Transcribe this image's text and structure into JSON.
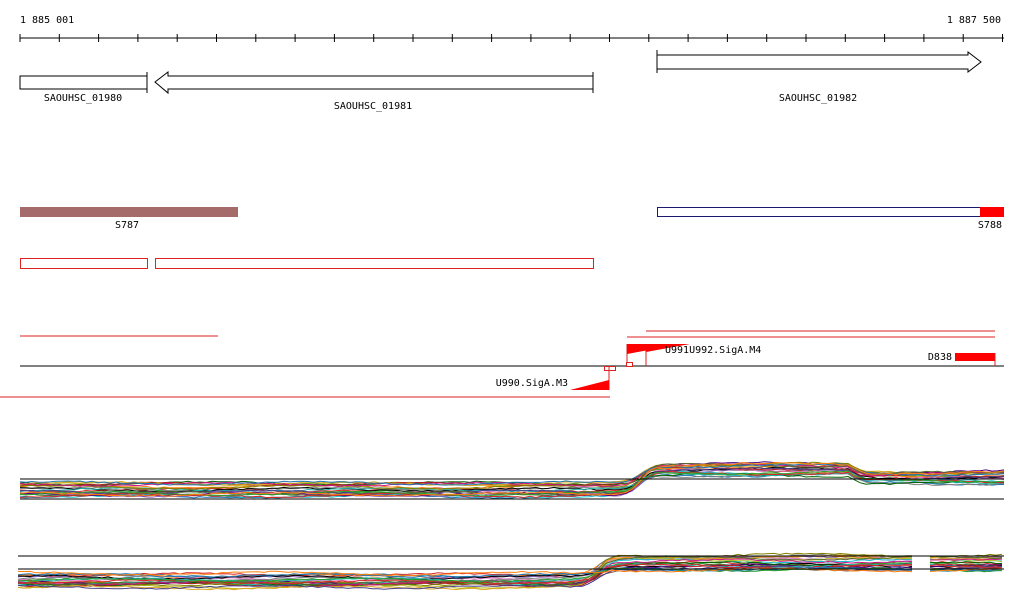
{
  "ruler": {
    "start_label": "1 885 001",
    "end_label": "1 887 500"
  },
  "genes": [
    {
      "name": "SAOUHSC_01980",
      "strand": "reverse"
    },
    {
      "name": "SAOUHSC_01981",
      "strand": "reverse"
    },
    {
      "name": "SAOUHSC_01982",
      "strand": "forward"
    }
  ],
  "segments": [
    {
      "name": "S787",
      "color": "#a56b6b"
    },
    {
      "name": "S788",
      "color": "#ff0000"
    }
  ],
  "features": {
    "upstream_left": "U990.SigA.M3",
    "upstream_right": "U991U992.SigA.M4",
    "downstream": "D838"
  },
  "colors": {
    "feature_red": "#ff0000",
    "outline_navy": "#1a1a6e",
    "axis_black": "#000000"
  },
  "expression_tracks": [
    {
      "name": "forward-strand-expression"
    },
    {
      "name": "reverse-strand-expression"
    }
  ]
}
